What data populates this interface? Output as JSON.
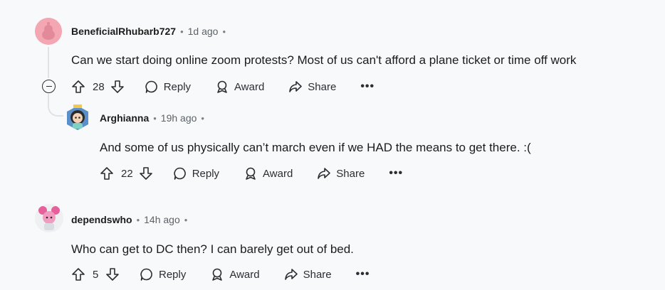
{
  "comments": [
    {
      "username": "BeneficialRhubarb727",
      "time": "1d ago",
      "dot": "•",
      "text": "Can we start doing online zoom protests? Most of us can't afford a plane ticket or time off work",
      "votes": "28",
      "avatar": "snoo-avatar-pink",
      "avatar_color": "#f4a6b3"
    },
    {
      "username": "Arghianna",
      "time": "19h ago",
      "dot": "•",
      "text": "And some of us physically can’t march even if we HAD the means to get there. :(",
      "votes": "22",
      "avatar": "character-avatar-crown"
    },
    {
      "username": "dependswho",
      "time": "14h ago",
      "dot": "•",
      "text": "Who can get to DC then? I can barely get out of bed.",
      "votes": "5",
      "avatar": "character-avatar-pink-hair"
    }
  ],
  "actions": {
    "reply": "Reply",
    "award": "Award",
    "share": "Share",
    "more": "•••"
  },
  "colors": {
    "background": "#f8f9fa",
    "thread_line": "#dfe2e6",
    "text": "#1c1c1c",
    "muted": "#5c6268"
  }
}
